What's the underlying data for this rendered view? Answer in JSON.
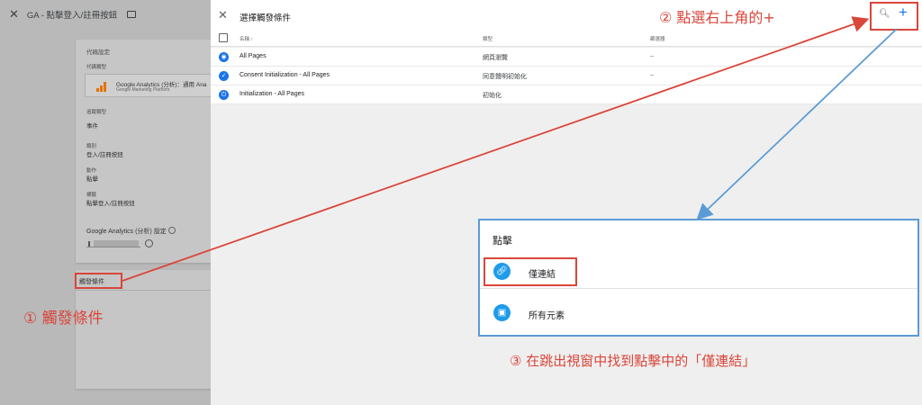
{
  "background_editor": {
    "close_icon": "close-icon",
    "title": "GA - 點擊登入/註冊按鈕",
    "folder_icon": "folder-icon",
    "tag_config_label": "代碼設定",
    "tag_type_label": "代碼類型",
    "product_name": "Google Analytics (分析)：通用 Ana",
    "product_sub": "Google Marketing Platform",
    "track_type_label": "追蹤類型",
    "track_type_value": "事件",
    "category_label": "類別",
    "category_value": "登入/註冊按鈕",
    "action_label": "動作",
    "action_value": "點擊",
    "event_label_label": "標籤",
    "event_label_value": "點擊登入/註冊按鈕",
    "ga_settings_label": "Google Analytics (分析) 設定",
    "triggering_label": "觸發條件"
  },
  "chooser": {
    "close_icon": "close-icon",
    "title": "選擇觸發條件",
    "search_icon": "search-icon",
    "add_icon": "plus-icon",
    "columns": {
      "name": "名稱 ↑",
      "type": "類型",
      "filter": "篩選器"
    },
    "rows": [
      {
        "name": "All Pages",
        "type": "網頁瀏覽",
        "filter": "–",
        "icon": "eye-icon"
      },
      {
        "name": "Consent Initialization - All Pages",
        "type": "同意聲明初始化",
        "filter": "–",
        "icon": "consent-icon"
      },
      {
        "name": "Initialization - All Pages",
        "type": "初始化",
        "filter": "",
        "icon": "power-icon"
      }
    ]
  },
  "popup": {
    "title": "點擊",
    "items": [
      {
        "label": "僅連結",
        "icon": "link-icon"
      },
      {
        "label": "所有元素",
        "icon": "pointer-icon"
      }
    ]
  },
  "annotations": {
    "step1": "① 觸發條件",
    "step2": "② 點選右上角的+",
    "step3": "③ 在跳出視窗中找到點擊中的「僅連結」"
  },
  "colors": {
    "annotation": "#d9463a",
    "popup_border": "#5b9bd5",
    "accent_blue": "#1a73e8"
  }
}
